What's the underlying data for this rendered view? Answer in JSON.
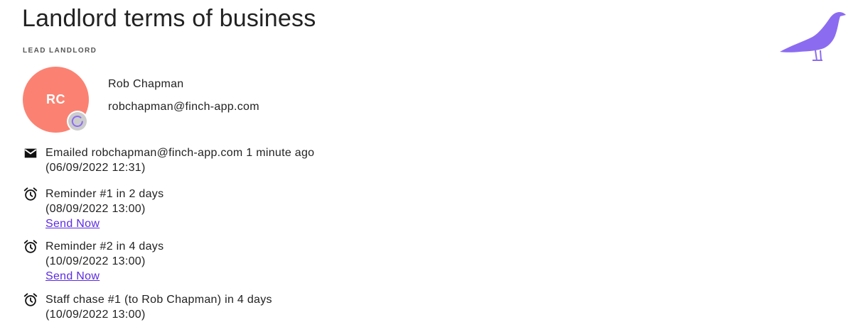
{
  "page": {
    "title": "Landlord terms of business"
  },
  "section": {
    "label": "LEAD LANDLORD"
  },
  "landlord": {
    "initials": "RC",
    "name": "Rob Chapman",
    "email": "robchapman@finch-app.com",
    "avatar_color": "#fb8272",
    "status_icon": "loading-spinner-icon"
  },
  "brand": {
    "logo_icon": "finch-bird-logo",
    "accent_color": "#8b6cf0"
  },
  "timeline": [
    {
      "icon": "mail-icon",
      "title": "Emailed robchapman@finch-app.com 1 minute ago",
      "date": "(06/09/2022 12:31)"
    },
    {
      "icon": "alarm-clock-icon",
      "title": "Reminder #1 in 2 days",
      "date": "(08/09/2022 13:00)",
      "action": "Send Now"
    },
    {
      "icon": "alarm-clock-icon",
      "title": "Reminder #2 in 4 days",
      "date": "(10/09/2022 13:00)",
      "action": "Send Now"
    },
    {
      "icon": "alarm-clock-icon",
      "title": "Staff chase #1 (to Rob Chapman) in 4 days",
      "date": "(10/09/2022 13:00)"
    }
  ]
}
